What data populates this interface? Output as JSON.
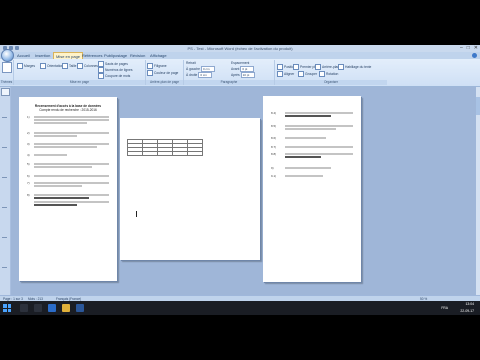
{
  "window": {
    "title": "PS - Test - Microsoft Word (échec de l'activation du produit)",
    "minimize": "–",
    "maximize": "□",
    "close": "✕"
  },
  "tabs": [
    {
      "label": "Accueil"
    },
    {
      "label": "Insertion"
    },
    {
      "label": "Mise en page",
      "active": true
    },
    {
      "label": "Références"
    },
    {
      "label": "Publipostage"
    },
    {
      "label": "Révision"
    },
    {
      "label": "Affichage"
    }
  ],
  "ribbon": {
    "groups": [
      {
        "label": "Thèmes",
        "buttons": [
          "Thèmes"
        ]
      },
      {
        "label": "Mise en page",
        "buttons": [
          "Marges",
          "Orientation",
          "Taille",
          "Colonnes",
          "Sauts de pages",
          "Numéros de lignes",
          "Coupure de mots"
        ]
      },
      {
        "label": "Arrière-plan de page",
        "buttons": [
          "Filigrane",
          "Couleur de page",
          "Bordures de page"
        ]
      },
      {
        "label": "Paragraphe",
        "retrait": "Retrait",
        "espacement": "Espacement",
        "gauche": "À gauche",
        "droite": "À droite",
        "avant": "Avant",
        "apres": "Après",
        "v1": "0 cm",
        "v2": "0 cm",
        "v3": "0 pt",
        "v4": "10 pt"
      },
      {
        "label": "Organiser",
        "buttons": [
          "Position",
          "Premier plan",
          "Arrière-plan",
          "Habillage du texte",
          "Aligner",
          "Grouper",
          "Rotation"
        ]
      }
    ]
  },
  "document": {
    "page1": {
      "heading1": "Recensement d'accès à la base de données",
      "heading2": "Compte rendu de recherche : 2015-2016",
      "items": [
        "1)",
        "2)",
        "3)",
        "4)",
        "5)",
        "6)",
        "7)",
        "8)"
      ]
    },
    "page2": {
      "table_headers": [
        "",
        "",
        "",
        "",
        ""
      ]
    },
    "page3": {
      "items": [
        "8.4)",
        "8.5)",
        "8.6)",
        "8.7)",
        "8.8)",
        "9)",
        "9.1)"
      ]
    }
  },
  "status": {
    "page": "Page : 1 sur 3",
    "words": "Mots : 213",
    "language": "Français (France)",
    "zoom": "50 %"
  },
  "taskbar": {
    "language": "FRA",
    "time": "13:04",
    "date": "22-09-17"
  },
  "colors": {
    "ribbon": "#dbe8f8",
    "workspace": "#9fb6d8",
    "taskbar": "#1a1d24",
    "accent": "#4aa3ff"
  }
}
